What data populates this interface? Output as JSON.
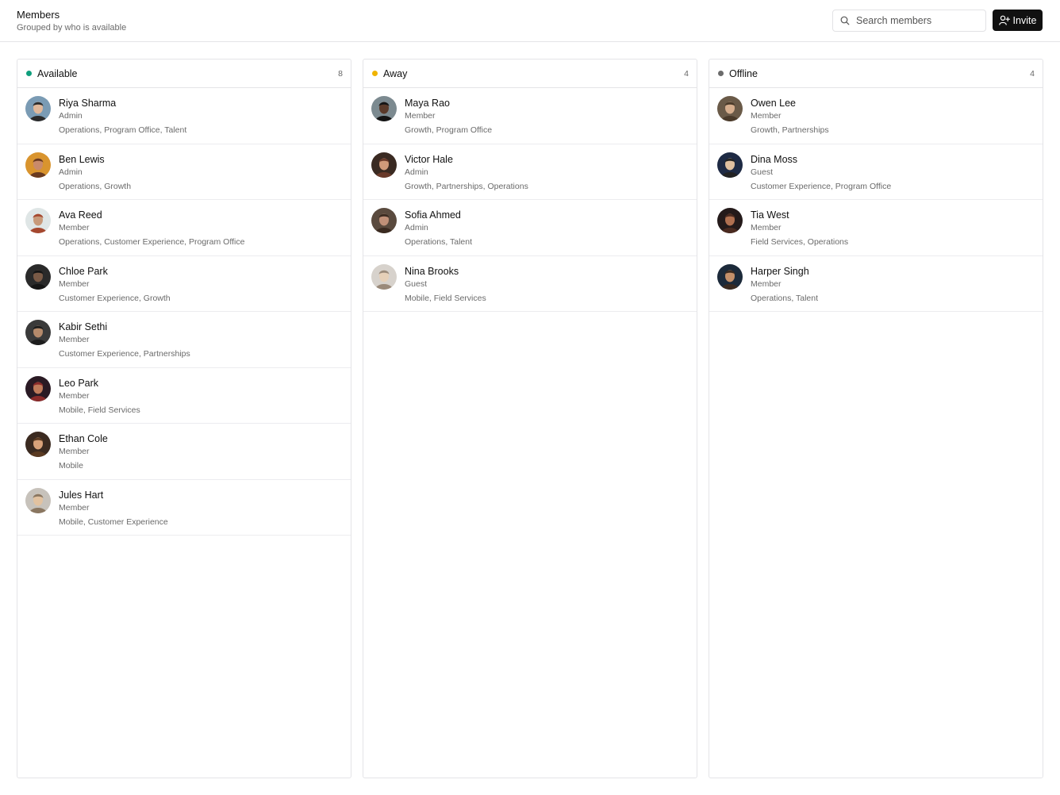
{
  "header": {
    "title": "Members",
    "subtitle": "Grouped by who is available",
    "search_placeholder": "Search members",
    "invite_label": "Invite"
  },
  "colors": {
    "available": "#0f9f7d",
    "away": "#f0b400",
    "offline": "#6b6b6b",
    "primary_button": "#111111"
  },
  "columns": [
    {
      "id": "available",
      "title": "Available",
      "count": "8",
      "members": [
        {
          "name": "Riya Sharma",
          "role": "Admin",
          "teams": "Operations, Program Office, Talent"
        },
        {
          "name": "Ben Lewis",
          "role": "Admin",
          "teams": "Operations, Growth"
        },
        {
          "name": "Ava Reed",
          "role": "Member",
          "teams": "Operations, Customer Experience, Program Office"
        },
        {
          "name": "Chloe Park",
          "role": "Member",
          "teams": "Customer Experience, Growth"
        },
        {
          "name": "Kabir Sethi",
          "role": "Member",
          "teams": "Customer Experience, Partnerships"
        },
        {
          "name": "Leo Park",
          "role": "Member",
          "teams": "Mobile, Field Services"
        },
        {
          "name": "Ethan Cole",
          "role": "Member",
          "teams": "Mobile"
        },
        {
          "name": "Jules Hart",
          "role": "Member",
          "teams": "Mobile, Customer Experience"
        }
      ]
    },
    {
      "id": "away",
      "title": "Away",
      "count": "4",
      "members": [
        {
          "name": "Maya Rao",
          "role": "Member",
          "teams": "Growth, Program Office"
        },
        {
          "name": "Victor Hale",
          "role": "Admin",
          "teams": "Growth, Partnerships, Operations"
        },
        {
          "name": "Sofia Ahmed",
          "role": "Admin",
          "teams": "Operations, Talent"
        },
        {
          "name": "Nina Brooks",
          "role": "Guest",
          "teams": "Mobile, Field Services"
        }
      ]
    },
    {
      "id": "offline",
      "title": "Offline",
      "count": "4",
      "members": [
        {
          "name": "Owen Lee",
          "role": "Member",
          "teams": "Growth, Partnerships"
        },
        {
          "name": "Dina Moss",
          "role": "Guest",
          "teams": "Customer Experience, Program Office"
        },
        {
          "name": "Tia West",
          "role": "Member",
          "teams": "Field Services, Operations"
        },
        {
          "name": "Harper Singh",
          "role": "Member",
          "teams": "Operations, Talent"
        }
      ]
    }
  ]
}
